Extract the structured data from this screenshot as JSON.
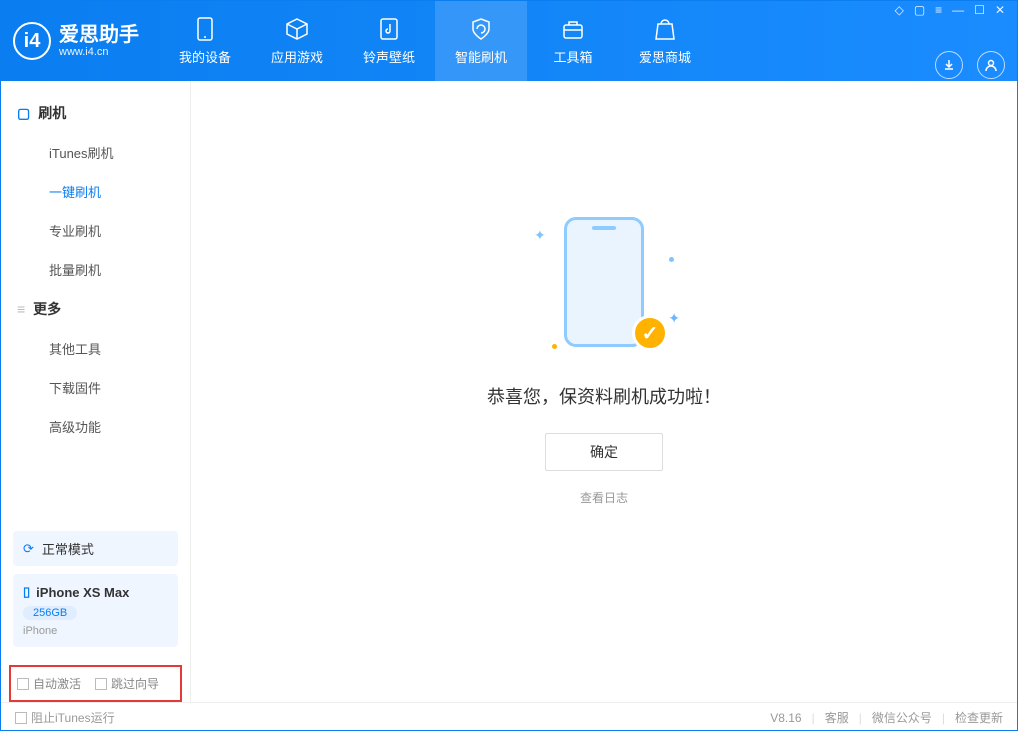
{
  "header": {
    "logo_title": "爱思助手",
    "logo_sub": "www.i4.cn",
    "tabs": [
      {
        "label": "我的设备"
      },
      {
        "label": "应用游戏"
      },
      {
        "label": "铃声壁纸"
      },
      {
        "label": "智能刷机"
      },
      {
        "label": "工具箱"
      },
      {
        "label": "爱思商城"
      }
    ]
  },
  "sidebar": {
    "group1_title": "刷机",
    "group1_items": [
      {
        "label": "iTunes刷机"
      },
      {
        "label": "一键刷机"
      },
      {
        "label": "专业刷机"
      },
      {
        "label": "批量刷机"
      }
    ],
    "group2_title": "更多",
    "group2_items": [
      {
        "label": "其他工具"
      },
      {
        "label": "下载固件"
      },
      {
        "label": "高级功能"
      }
    ],
    "mode_label": "正常模式",
    "device_name": "iPhone XS Max",
    "device_storage": "256GB",
    "device_type": "iPhone",
    "cb_auto_activate": "自动激活",
    "cb_skip_guide": "跳过向导"
  },
  "main": {
    "success_text": "恭喜您，保资料刷机成功啦！",
    "ok_button": "确定",
    "view_log": "查看日志"
  },
  "footer": {
    "block_itunes": "阻止iTunes运行",
    "version": "V8.16",
    "link_support": "客服",
    "link_wechat": "微信公众号",
    "link_update": "检查更新"
  }
}
